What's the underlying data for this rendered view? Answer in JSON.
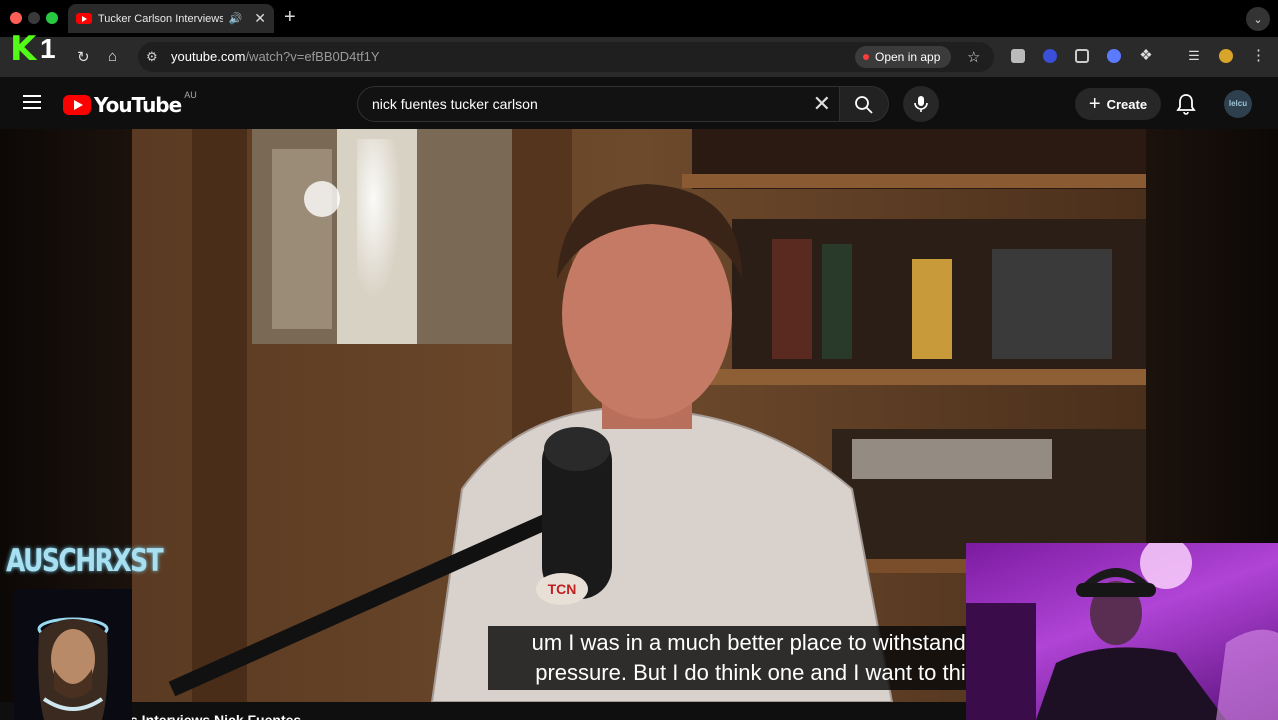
{
  "browser": {
    "tab": {
      "title": "Tucker Carlson Interviews Nick Fuentes"
    },
    "omnibox": {
      "url_domain": "youtube.com",
      "url_path": "/watch?v=efBB0D4tf1Y",
      "open_in_app": "Open in app"
    },
    "overlay_logo": {
      "letter_k": "K",
      "digit": "1"
    }
  },
  "youtube": {
    "logo": {
      "word": "YouTube",
      "country": "AU"
    },
    "search": {
      "query": "nick fuentes tucker carlson"
    },
    "create_label": "Create",
    "avatar_text": "Ielcu"
  },
  "video": {
    "captions": [
      "um I was in a much better place to withstand the",
      "pressure. But I do think one and I want to this is"
    ],
    "title_fragment": "s Interviews Nick Fuentes",
    "mic_flag_text": "TCN"
  },
  "overlays": {
    "brand_text": "AUSCHRXST"
  },
  "colors": {
    "youtube_red": "#ff0000",
    "kick_green": "#53fc18",
    "webcam_tint": "#b044d6"
  }
}
